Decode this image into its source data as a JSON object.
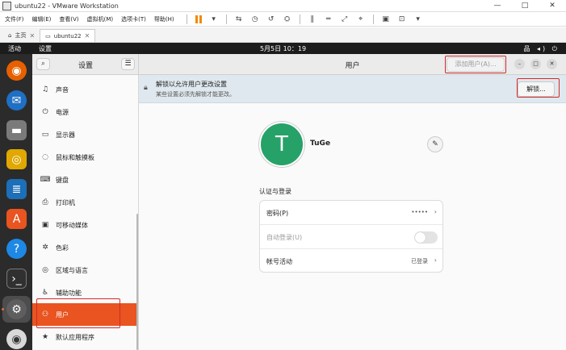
{
  "vmware": {
    "title": "ubuntu22 - VMware Workstation",
    "window_buttons": [
      "—",
      "□",
      "✕"
    ],
    "menus": [
      "文件(F)",
      "编辑(E)",
      "查看(V)",
      "虚拟机(M)",
      "选项卡(T)",
      "帮助(H)"
    ],
    "tabs": [
      {
        "label": "主页"
      },
      {
        "label": "ubuntu22"
      }
    ]
  },
  "topbar": {
    "activities": "活动",
    "app": "设置",
    "clock": "5月5日 10：19",
    "tray": "品 ◂) ⏻"
  },
  "settings": {
    "sidebar_title": "设置",
    "search_icon": "search-icon",
    "menu_icon": "hamburger-icon",
    "items": [
      {
        "label": "声音",
        "icon": "♫"
      },
      {
        "label": "电源",
        "icon": "⏻"
      },
      {
        "label": "显示器",
        "icon": "▭"
      },
      {
        "label": "鼠标和触摸板",
        "icon": "◌"
      },
      {
        "label": "键盘",
        "icon": "⌨"
      },
      {
        "label": "打印机",
        "icon": "⎙"
      },
      {
        "label": "可移动媒体",
        "icon": "▣"
      },
      {
        "label": "色彩",
        "icon": "✲"
      },
      {
        "label": "区域与语言",
        "icon": "◎"
      },
      {
        "label": "辅助功能",
        "icon": "♿"
      },
      {
        "label": "用户",
        "icon": "⚇"
      },
      {
        "label": "默认应用程序",
        "icon": "★"
      }
    ],
    "selected_item": "用户"
  },
  "users_page": {
    "title": "用户",
    "add_user": "添加用户(A)...",
    "banner_title": "解锁以允许用户更改设置",
    "banner_sub": "某些设置必须先解锁才能更改。",
    "unlock_button": "解锁...",
    "avatar_letter": "T",
    "username": "TuGe",
    "section_title": "认证与登录",
    "rows": [
      {
        "label": "密码(P)",
        "value": "•••••"
      },
      {
        "label": "自动登录(U)",
        "value": ""
      },
      {
        "label": "帐号活动",
        "value": "已登录"
      }
    ]
  },
  "colors": {
    "accent": "#e95420",
    "avatar": "#26a269",
    "annotation": "#d12b2b"
  }
}
